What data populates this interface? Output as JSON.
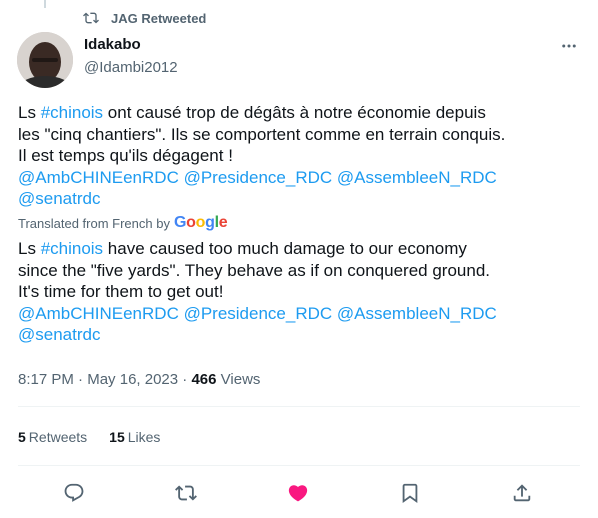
{
  "retweet": {
    "label": "JAG Retweeted"
  },
  "author": {
    "name": "Idakabo",
    "handle": "@Idambi2012"
  },
  "original": {
    "line1": {
      "pre": "Ls ",
      "hashtag": "#chinois",
      "post": " ont causé trop de dégâts à notre économie depuis"
    },
    "line2": "les \"cinq chantiers\". Ils se comportent comme en terrain conquis.",
    "line3": "Il est temps qu'ils dégagent !",
    "mentions_line1": "@AmbCHINEenRDC @Presidence_RDC @AssembleeN_RDC",
    "mentions_line2": "@senatrdc"
  },
  "translation_label": "Translated from French by",
  "translation_provider": "Google",
  "translated": {
    "line1": {
      "pre": "Ls ",
      "hashtag": "#chinois",
      "post": " have caused too much damage to our economy"
    },
    "line2": "since the \"five yards\". They behave as if on conquered ground.",
    "line3": "It's time for them to get out!",
    "mentions_line1": "@AmbCHINEenRDC @Presidence_RDC @AssembleeN_RDC",
    "mentions_line2": "@senatrdc"
  },
  "meta": {
    "time": "8:17 PM",
    "sep": " · ",
    "date": "May 16, 2023",
    "sep2": " · ",
    "views_count": "466",
    "views_label": " Views"
  },
  "stats": {
    "retweets_count": "5",
    "retweets_label": "Retweets",
    "likes_count": "15",
    "likes_label": "Likes"
  },
  "colors": {
    "link": "#1d9bf0",
    "secondary": "#536471",
    "like": "#f91880"
  },
  "icons": [
    "retweet-icon",
    "more-icon",
    "reply-icon",
    "heart-icon",
    "bookmark-icon",
    "share-icon"
  ]
}
